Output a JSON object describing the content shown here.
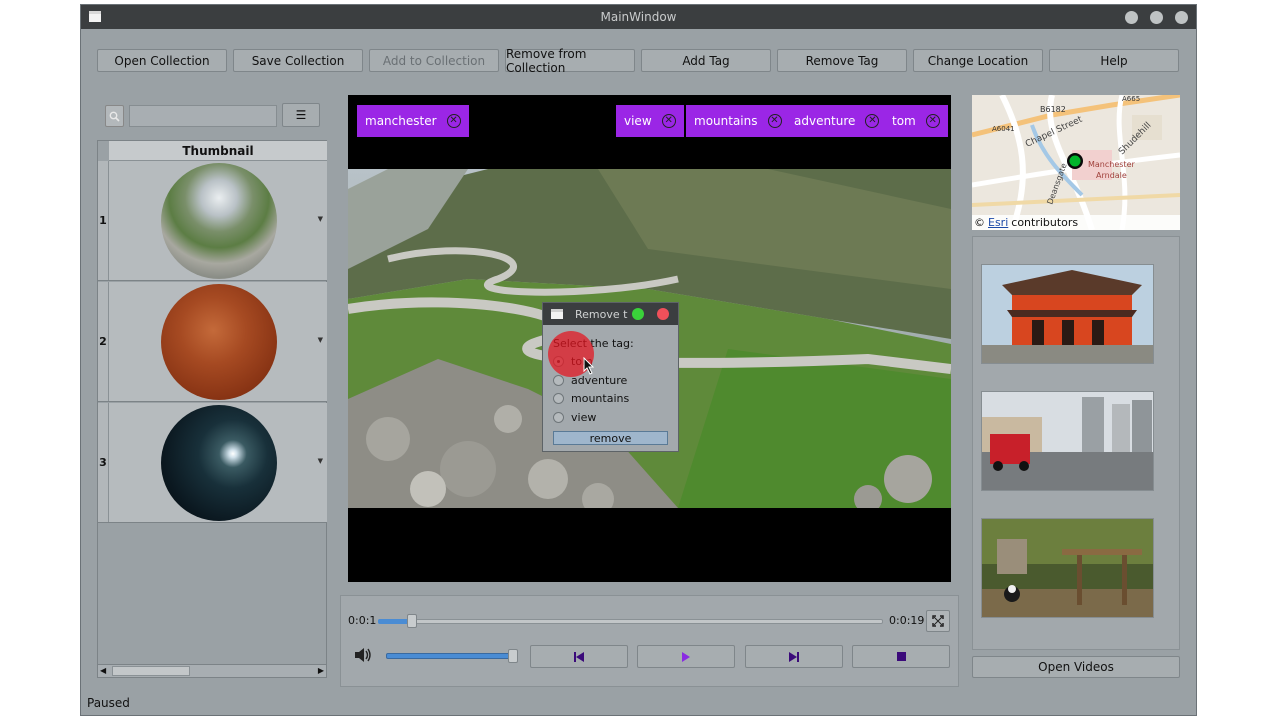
{
  "window": {
    "title": "MainWindow"
  },
  "toolbar": {
    "open_collection": "Open Collection",
    "save_collection": "Save Collection",
    "add_to_collection": "Add to Collection",
    "remove_from_collection": "Remove from Collection",
    "add_tag": "Add Tag",
    "remove_tag": "Remove Tag",
    "change_location": "Change Location",
    "help": "Help"
  },
  "sidebar": {
    "search_placeholder": "",
    "menu_glyph": "☰",
    "column_header": "Thumbnail",
    "rows": [
      {
        "num": "1"
      },
      {
        "num": "2"
      },
      {
        "num": "3"
      }
    ]
  },
  "video": {
    "tags": [
      "manchester",
      "view",
      "mountains",
      "adventure",
      "tom"
    ]
  },
  "dialog": {
    "title": "Remove t",
    "prompt": "Select the tag:",
    "options": [
      "tom",
      "adventure",
      "mountains",
      "view"
    ],
    "selected": "tom",
    "button": "remove"
  },
  "player": {
    "current_time": "0:0:1",
    "total_time": "0:0:19",
    "progress": 0.06,
    "volume": 0.98,
    "status": "Paused"
  },
  "map": {
    "labels": [
      "B6182",
      "A665",
      "A6041",
      "Chapel Street",
      "Shudehill",
      "Manchester",
      "Arndale",
      "Deansgate"
    ],
    "attribution_prefix": "©",
    "attribution_link": "Esri",
    "attribution_suffix": "contributors"
  },
  "right_panel": {
    "open_videos": "Open Videos"
  },
  "colors": {
    "tag_bg": "#9b26e6",
    "accent_blue": "#4a8cd4",
    "titlebar": "#3b3e40"
  }
}
